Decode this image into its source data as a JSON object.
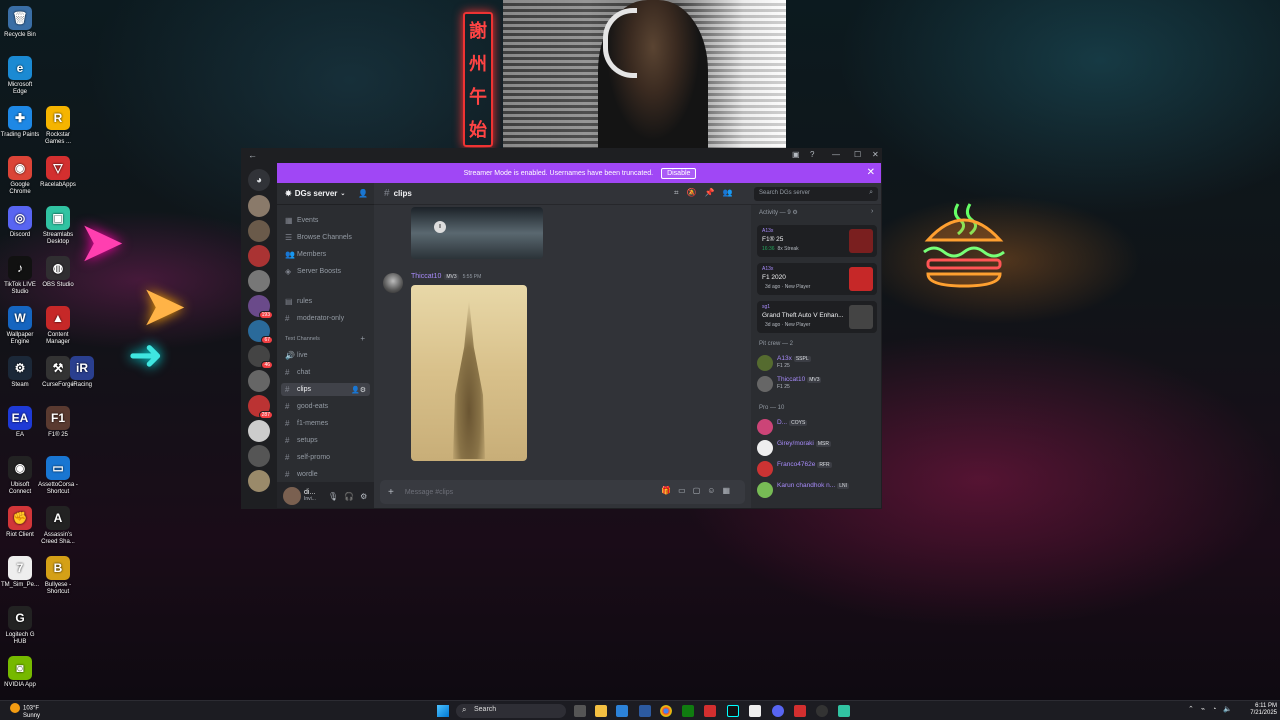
{
  "desktop": {
    "icons": [
      {
        "label": "Recycle Bin",
        "glyph": "🗑",
        "color": "#3a6ea5"
      },
      {
        "label": "Microsoft Edge",
        "glyph": "e",
        "color": "#1b8ad3"
      },
      {
        "label": "Trading Paints",
        "glyph": "✚",
        "color": "#1e88e5"
      },
      {
        "label": "Rockstar Games ...",
        "glyph": "R",
        "color": "#f5b400"
      },
      {
        "label": "Google Chrome",
        "glyph": "◉",
        "color": "#db4437"
      },
      {
        "label": "RacelabApps",
        "glyph": "▽",
        "color": "#d32f2f"
      },
      {
        "label": "Discord",
        "glyph": "◎",
        "color": "#5865f2"
      },
      {
        "label": "Streamlabs Desktop",
        "glyph": "▣",
        "color": "#31c3a2"
      },
      {
        "label": "TikTok LIVE Studio",
        "glyph": "♪",
        "color": "#111111"
      },
      {
        "label": "OBS Studio",
        "glyph": "◍",
        "color": "#302e31"
      },
      {
        "label": "Wallpaper Engine",
        "glyph": "W",
        "color": "#1565c0"
      },
      {
        "label": "Content Manager",
        "glyph": "▲",
        "color": "#c62828"
      },
      {
        "label": "Steam",
        "glyph": "⚙",
        "color": "#1b2838"
      },
      {
        "label": "CurseForge",
        "glyph": "⚒",
        "color": "#333333"
      },
      {
        "label": "iRacing",
        "glyph": "iR",
        "color": "#2a3f8f"
      },
      {
        "label": "EA",
        "glyph": "EA",
        "color": "#1e3ad6"
      },
      {
        "label": "F1® 25",
        "glyph": "F1",
        "color": "#5a3a30"
      },
      {
        "label": "Ubisoft Connect",
        "glyph": "◉",
        "color": "#222222"
      },
      {
        "label": "AssettoCorsa - Shortcut",
        "glyph": "▭",
        "color": "#1976d2"
      },
      {
        "label": "Riot Client",
        "glyph": "✊",
        "color": "#d13639"
      },
      {
        "label": "Assassin's Creed Sha...",
        "glyph": "A",
        "color": "#222222"
      },
      {
        "label": "TM_Sim_Pe...",
        "glyph": "7",
        "color": "#eeeeee"
      },
      {
        "label": "Bullyese - Shortcut",
        "glyph": "B",
        "color": "#d4a017"
      },
      {
        "label": "Logitech G HUB",
        "glyph": "G",
        "color": "#222222"
      },
      {
        "label": "NVIDIA App",
        "glyph": "◙",
        "color": "#76b900"
      }
    ]
  },
  "discord": {
    "streamer_banner": "Streamer Mode is enabled. Usernames have been truncated.",
    "disable_label": "Disable",
    "server_name": "DGs server",
    "nav_items": [
      {
        "label": "Events",
        "glyph": "▦"
      },
      {
        "label": "Browse Channels",
        "glyph": "☰"
      },
      {
        "label": "Members",
        "glyph": "👥"
      },
      {
        "label": "Server Boosts",
        "glyph": "◈"
      }
    ],
    "channels_top": [
      {
        "label": "rules",
        "glyph": "▤"
      },
      {
        "label": "moderator-only",
        "glyph": "#"
      }
    ],
    "category": "Text Channels",
    "channels": [
      {
        "label": "live",
        "glyph": "🔊"
      },
      {
        "label": "chat",
        "glyph": "#"
      },
      {
        "label": "clips",
        "glyph": "#",
        "active": true
      },
      {
        "label": "good-eats",
        "glyph": "#"
      },
      {
        "label": "f1-memes",
        "glyph": "#"
      },
      {
        "label": "setups",
        "glyph": "#"
      },
      {
        "label": "self-promo",
        "glyph": "#"
      },
      {
        "label": "wordle",
        "glyph": "#"
      }
    ],
    "user": {
      "name": "di...",
      "status": "Invi..."
    },
    "guild_badges": [
      "193",
      "67",
      "46",
      "287"
    ],
    "channel_title": "clips",
    "search_placeholder": "Search DGs server",
    "message": {
      "author": "Thiccat10",
      "tag": "MV3",
      "time": "5:55 PM"
    },
    "composer_placeholder": "Message #clips",
    "activity_header": "Activity — 9",
    "activities": [
      {
        "who": "A13x",
        "game": "F1® 25",
        "meta_dur": "16:36",
        "meta": "8x Streak",
        "color": "#7a1f1f"
      },
      {
        "who": "A13x",
        "game": "F1 2020",
        "meta_dur": "",
        "meta": "3d ago · New Player",
        "color": "#c62828"
      },
      {
        "who": "sg1",
        "game": "Grand Theft Auto V Enhan...",
        "meta_dur": "",
        "meta": "3d ago · New Player",
        "color": "#444444"
      }
    ],
    "pit_crew_header": "Pit crew — 2",
    "pit_crew": [
      {
        "name": "A13x",
        "tag": "SSPL",
        "status": "F1 25",
        "color": "#556b2f"
      },
      {
        "name": "Thiccat10",
        "tag": "MV3",
        "status": "F1 25",
        "color": "#666666"
      }
    ],
    "pro_header": "Pro — 10",
    "pros": [
      {
        "name": "D...",
        "tag": "COYS",
        "color": "#c47"
      },
      {
        "name": "Girey/moraki",
        "tag": "MSR",
        "color": "#eee"
      },
      {
        "name": "Franco4762e",
        "tag": "RFR",
        "color": "#c33"
      },
      {
        "name": "Karun chandhok n...",
        "tag": "LNI",
        "color": "#7b5"
      }
    ]
  },
  "taskbar": {
    "weather_temp": "103°F",
    "weather_desc": "Sunny",
    "search_label": "Search",
    "time": "6:11 PM",
    "date": "7/21/2025"
  },
  "colors": {
    "discord_accent": "#a047f5",
    "username": "#a78bfa"
  }
}
